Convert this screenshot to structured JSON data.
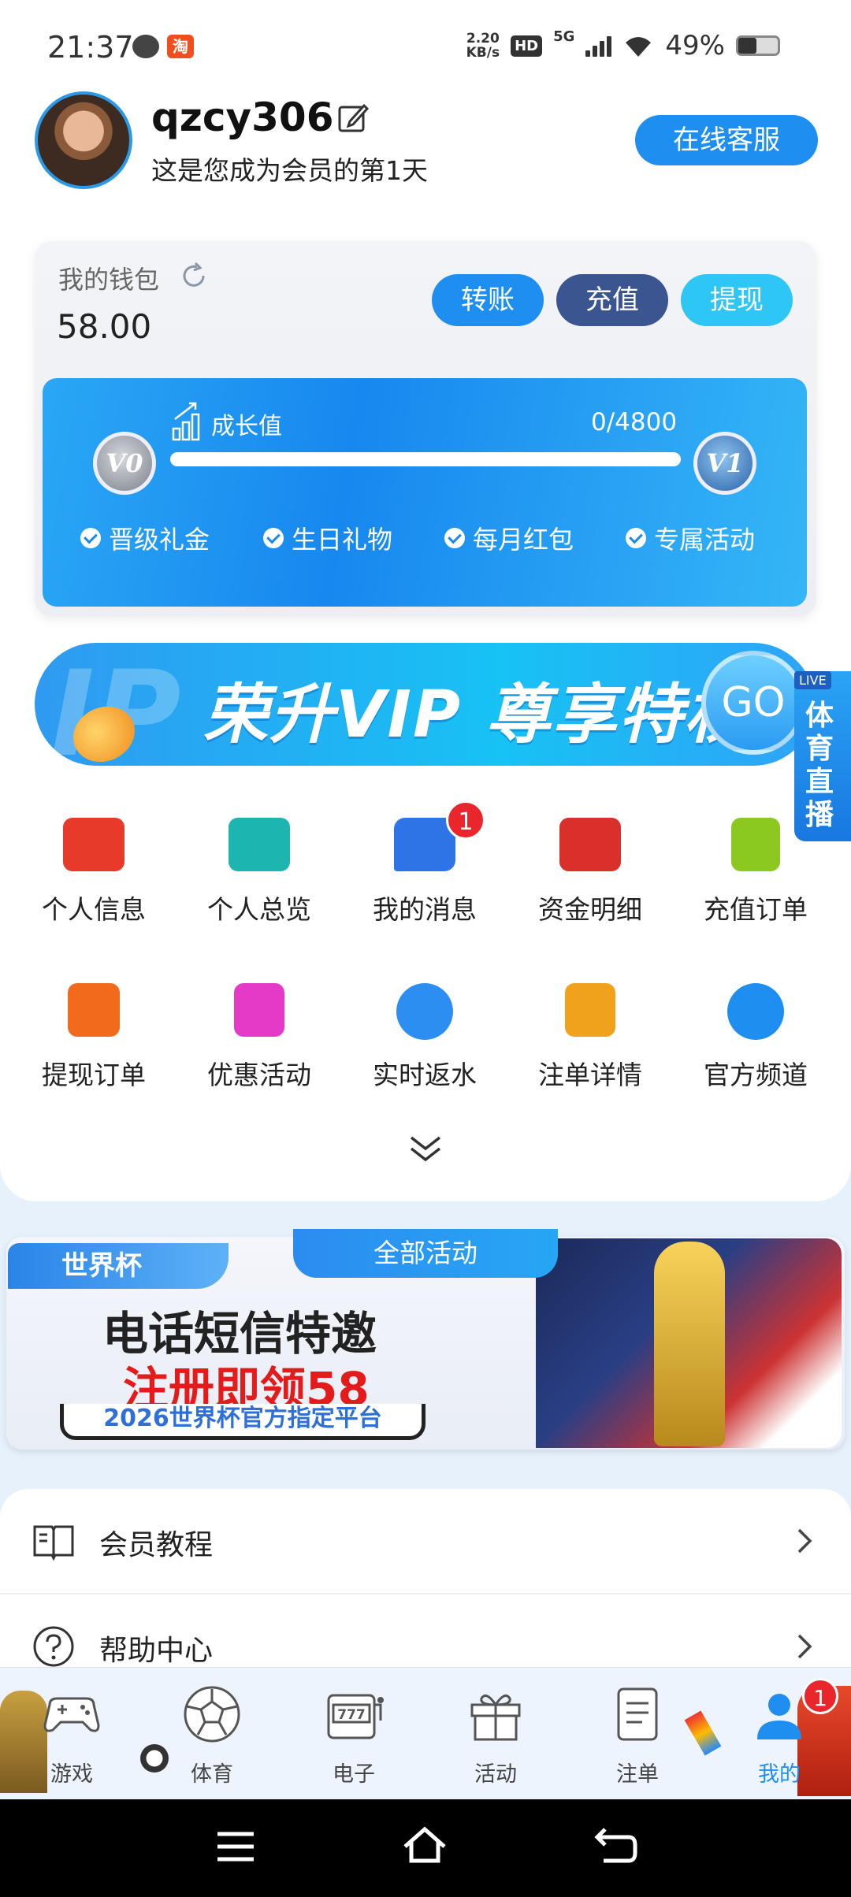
{
  "status": {
    "time": "21:37",
    "speed_top": "2.20",
    "speed_unit": "KB/s",
    "hd": "HD",
    "net": "5G",
    "battery": "49%",
    "taobao_icon": "淘"
  },
  "profile": {
    "username": "qzcy306",
    "subtitle": "这是您成为会员的第1天",
    "support_button": "在线客服"
  },
  "wallet": {
    "title": "我的钱包",
    "amount": "58.00",
    "transfer": "转账",
    "deposit": "充值",
    "withdraw": "提现"
  },
  "growth": {
    "label": "成长值",
    "value": "0/4800",
    "progress": 0,
    "badge_from": "V0",
    "badge_to": "V1",
    "perks": [
      "晋级礼金",
      "生日礼物",
      "每月红包",
      "专属活动"
    ]
  },
  "vip_banner": {
    "text": "荣升VIP 尊享特权",
    "go": "GO"
  },
  "live": {
    "tag": "LIVE",
    "text": "体育直播"
  },
  "grid": [
    {
      "label": "个人信息",
      "icon": "id-card-icon",
      "color": "#e83a2a"
    },
    {
      "label": "个人总览",
      "icon": "profile-card-icon",
      "color": "#1cb5b0"
    },
    {
      "label": "我的消息",
      "icon": "chat-bubble-icon",
      "color": "#2f74e6",
      "badge": "1"
    },
    {
      "label": "资金明细",
      "icon": "money-detail-icon",
      "color": "#d9302a"
    },
    {
      "label": "充值订单",
      "icon": "clipboard-icon",
      "color": "#8bc820"
    },
    {
      "label": "提现订单",
      "icon": "withdraw-order-icon",
      "color": "#f26b1d"
    },
    {
      "label": "优惠活动",
      "icon": "gift-icon",
      "color": "#e53ac8"
    },
    {
      "label": "实时返水",
      "icon": "rebate-icon",
      "color": "#2b8ef0"
    },
    {
      "label": "注单详情",
      "icon": "bet-detail-icon",
      "color": "#f0a21d"
    },
    {
      "label": "官方频道",
      "icon": "telegram-icon",
      "color": "#1e8ef0"
    }
  ],
  "worldcup": {
    "tag": "世界杯",
    "all_events": "全部活动",
    "line1": "电话短信特邀",
    "line2": "注册即领58",
    "line3": "2026世界杯官方指定平台"
  },
  "list": [
    {
      "label": "会员教程",
      "icon": "book-icon"
    },
    {
      "label": "帮助中心",
      "icon": "help-icon"
    }
  ],
  "tabs": [
    {
      "label": "游戏",
      "icon": "gamepad-icon"
    },
    {
      "label": "体育",
      "icon": "soccer-ball-icon"
    },
    {
      "label": "电子",
      "icon": "slot-machine-icon"
    },
    {
      "label": "活动",
      "icon": "gift-box-icon"
    },
    {
      "label": "注单",
      "icon": "receipt-icon"
    },
    {
      "label": "我的",
      "icon": "user-icon",
      "badge": "1",
      "active": true
    }
  ]
}
